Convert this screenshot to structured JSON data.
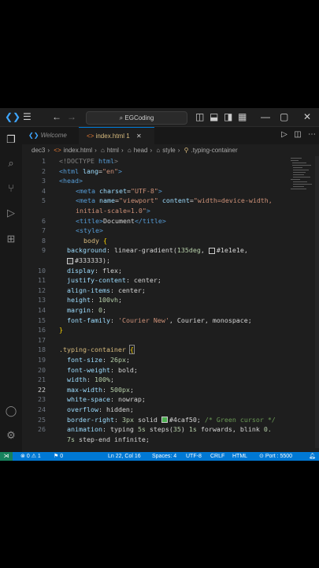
{
  "titlebar": {
    "search": "EGCoding"
  },
  "tabs": {
    "welcome": "Welcome",
    "index": "index.html 1"
  },
  "breadcrumb": [
    "dec3",
    "index.html",
    "html",
    "head",
    "style",
    ".typing-container"
  ],
  "editor": {
    "active_line": "22",
    "lines": [
      {
        "n": "1"
      },
      {
        "n": "2"
      },
      {
        "n": "3"
      },
      {
        "n": "4"
      },
      {
        "n": "5"
      },
      {
        "n": ""
      },
      {
        "n": "6"
      },
      {
        "n": "7"
      },
      {
        "n": "8"
      },
      {
        "n": "9"
      },
      {
        "n": ""
      },
      {
        "n": "10"
      },
      {
        "n": "11"
      },
      {
        "n": "12"
      },
      {
        "n": "13"
      },
      {
        "n": "14"
      },
      {
        "n": "15"
      },
      {
        "n": "16"
      },
      {
        "n": "17"
      },
      {
        "n": "18"
      },
      {
        "n": "19"
      },
      {
        "n": "20"
      },
      {
        "n": "21"
      },
      {
        "n": "22"
      },
      {
        "n": "23"
      },
      {
        "n": "24"
      },
      {
        "n": "25"
      },
      {
        "n": "26"
      },
      {
        "n": ""
      }
    ],
    "code": {
      "l1_a": "<!DOCTYPE ",
      "l1_b": "html",
      "l1_c": ">",
      "l2_a": "<html ",
      "l2_b": "lang",
      "l2_c": "=",
      "l2_d": "\"en\"",
      "l2_e": ">",
      "l3": "<head>",
      "l4_a": "<meta ",
      "l4_b": "charset",
      "l4_c": "=",
      "l4_d": "\"UTF-8\"",
      "l4_e": ">",
      "l5_a": "<meta ",
      "l5_b": "name",
      "l5_c": "=",
      "l5_d": "\"viewport\"",
      "l5_e": " content",
      "l5_f": "=",
      "l5_g": "\"width=device-width,",
      "l5w": "initial-scale=1.0\"",
      "l5w_b": ">",
      "l6_a": "<title>",
      "l6_b": "Document",
      "l6_c": "</title>",
      "l7": "<style>",
      "l8_a": "body ",
      "l8_b": "{",
      "l9_a": "background",
      "l9_b": ": linear-gradient(",
      "l9_c": "135deg",
      "l9_d": ", ",
      "l9_e": "#1e1e1e",
      "l9_f": ",",
      "l9w_a": "#333333",
      "l9w_b": ");",
      "l10_a": "display",
      "l10_b": ": flex;",
      "l11_a": "justify-content",
      "l11_b": ": center;",
      "l12_a": "align-items",
      "l12_b": ": center;",
      "l13_a": "height",
      "l13_b": ": ",
      "l13_c": "100vh",
      "l13_d": ";",
      "l14_a": "margin",
      "l14_b": ": ",
      "l14_c": "0",
      "l14_d": ";",
      "l15_a": "font-family",
      "l15_b": ": ",
      "l15_c": "'Courier New'",
      "l15_d": ", Courier, monospace;",
      "l16": "}",
      "l18_a": ".typing-container ",
      "l18_b": "{",
      "l19_a": "font-size",
      "l19_b": ": ",
      "l19_c": "26px",
      "l19_d": ";",
      "l20_a": "font-weight",
      "l20_b": ": bold;",
      "l21_a": "width",
      "l21_b": ": ",
      "l21_c": "100%",
      "l21_d": ";",
      "l22_a": "max-width",
      "l22_b": ": ",
      "l22_c": "500px",
      "l22_d": ";",
      "l23_a": "white-space",
      "l23_b": ": nowrap;",
      "l24_a": "overflow",
      "l24_b": ": hidden;",
      "l25_a": "border-right",
      "l25_b": ": ",
      "l25_c": "3px",
      "l25_d": " solid ",
      "l25_e": "#4caf50",
      "l25_f": "; ",
      "l25_g": "/* Green cursor */",
      "l26_a": "animation",
      "l26_b": ": typing ",
      "l26_c": "5s",
      "l26_d": " steps(",
      "l26_e": "35",
      "l26_f": ") ",
      "l26_g": "1s",
      "l26_h": " forwards, blink ",
      "l26_i": "0.",
      "l26w_a": "7s",
      "l26w_b": " step-end infinite;"
    }
  },
  "status": {
    "errors": "0",
    "warnings": "1",
    "ports_count": "0",
    "position": "Ln 22, Col 16",
    "spaces": "Spaces: 4",
    "encoding": "UTF-8",
    "eol": "CRLF",
    "language": "HTML",
    "port": "Port : 5500"
  },
  "colors": {
    "accent": "#0078d4",
    "background": "#1e1e1e",
    "swatch_1": "#1e1e1e",
    "swatch_2": "#333333",
    "swatch_3": "#4caf50"
  }
}
